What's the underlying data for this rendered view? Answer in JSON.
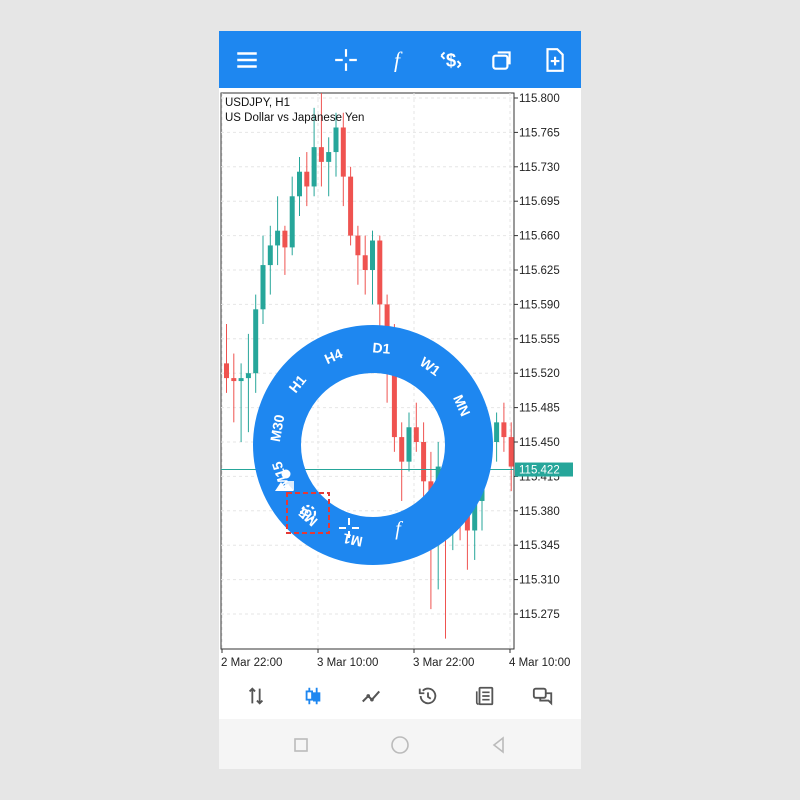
{
  "toolbar": {
    "icons": [
      "menu-icon",
      "crosshair-icon",
      "function-icon",
      "trade-icon",
      "window-icon",
      "new-order-icon"
    ]
  },
  "chart": {
    "symbol": "USDJPY, H1",
    "description": "US Dollar vs Japanese Yen",
    "current_price": "115.422",
    "price_labels": [
      "115.800",
      "115.765",
      "115.730",
      "115.695",
      "115.660",
      "115.625",
      "115.590",
      "115.555",
      "115.520",
      "115.485",
      "115.450",
      "115.415",
      "115.380",
      "115.345",
      "115.310",
      "115.275"
    ],
    "time_labels": [
      "2 Mar 22:00",
      "3 Mar 10:00",
      "3 Mar 22:00",
      "4 Mar 10:00"
    ],
    "colors": {
      "up": "#26a69a",
      "down": "#ef5350",
      "accent": "#1e87f0"
    }
  },
  "chart_data": {
    "type": "candlestick",
    "symbol": "USDJPY",
    "timeframe": "H1",
    "ylim": [
      115.25,
      115.81
    ],
    "grid": true,
    "candles": [
      {
        "o": 115.53,
        "h": 115.57,
        "l": 115.5,
        "c": 115.515
      },
      {
        "o": 115.515,
        "h": 115.54,
        "l": 115.47,
        "c": 115.512
      },
      {
        "o": 115.512,
        "h": 115.53,
        "l": 115.45,
        "c": 115.515
      },
      {
        "o": 115.515,
        "h": 115.56,
        "l": 115.46,
        "c": 115.52
      },
      {
        "o": 115.52,
        "h": 115.6,
        "l": 115.5,
        "c": 115.585
      },
      {
        "o": 115.585,
        "h": 115.66,
        "l": 115.57,
        "c": 115.63
      },
      {
        "o": 115.63,
        "h": 115.67,
        "l": 115.6,
        "c": 115.65
      },
      {
        "o": 115.65,
        "h": 115.7,
        "l": 115.63,
        "c": 115.665
      },
      {
        "o": 115.665,
        "h": 115.67,
        "l": 115.62,
        "c": 115.648
      },
      {
        "o": 115.648,
        "h": 115.72,
        "l": 115.64,
        "c": 115.7
      },
      {
        "o": 115.7,
        "h": 115.74,
        "l": 115.68,
        "c": 115.725
      },
      {
        "o": 115.725,
        "h": 115.745,
        "l": 115.69,
        "c": 115.71
      },
      {
        "o": 115.71,
        "h": 115.79,
        "l": 115.7,
        "c": 115.75
      },
      {
        "o": 115.75,
        "h": 115.805,
        "l": 115.71,
        "c": 115.735
      },
      {
        "o": 115.735,
        "h": 115.76,
        "l": 115.7,
        "c": 115.745
      },
      {
        "o": 115.745,
        "h": 115.785,
        "l": 115.72,
        "c": 115.77
      },
      {
        "o": 115.77,
        "h": 115.785,
        "l": 115.69,
        "c": 115.72
      },
      {
        "o": 115.72,
        "h": 115.73,
        "l": 115.65,
        "c": 115.66
      },
      {
        "o": 115.66,
        "h": 115.67,
        "l": 115.61,
        "c": 115.64
      },
      {
        "o": 115.64,
        "h": 115.66,
        "l": 115.6,
        "c": 115.625
      },
      {
        "o": 115.625,
        "h": 115.665,
        "l": 115.59,
        "c": 115.655
      },
      {
        "o": 115.655,
        "h": 115.66,
        "l": 115.56,
        "c": 115.59
      },
      {
        "o": 115.59,
        "h": 115.6,
        "l": 115.49,
        "c": 115.56
      },
      {
        "o": 115.56,
        "h": 115.57,
        "l": 115.44,
        "c": 115.455
      },
      {
        "o": 115.455,
        "h": 115.47,
        "l": 115.39,
        "c": 115.43
      },
      {
        "o": 115.43,
        "h": 115.48,
        "l": 115.42,
        "c": 115.465
      },
      {
        "o": 115.465,
        "h": 115.49,
        "l": 115.44,
        "c": 115.45
      },
      {
        "o": 115.45,
        "h": 115.47,
        "l": 115.38,
        "c": 115.41
      },
      {
        "o": 115.41,
        "h": 115.44,
        "l": 115.28,
        "c": 115.4
      },
      {
        "o": 115.4,
        "h": 115.45,
        "l": 115.3,
        "c": 115.425
      },
      {
        "o": 115.425,
        "h": 115.45,
        "l": 115.25,
        "c": 115.4
      },
      {
        "o": 115.4,
        "h": 115.44,
        "l": 115.34,
        "c": 115.42
      },
      {
        "o": 115.42,
        "h": 115.43,
        "l": 115.35,
        "c": 115.38
      },
      {
        "o": 115.38,
        "h": 115.4,
        "l": 115.32,
        "c": 115.36
      },
      {
        "o": 115.36,
        "h": 115.42,
        "l": 115.33,
        "c": 115.39
      },
      {
        "o": 115.39,
        "h": 115.45,
        "l": 115.36,
        "c": 115.44
      },
      {
        "o": 115.44,
        "h": 115.47,
        "l": 115.42,
        "c": 115.45
      },
      {
        "o": 115.45,
        "h": 115.48,
        "l": 115.43,
        "c": 115.47
      },
      {
        "o": 115.47,
        "h": 115.49,
        "l": 115.44,
        "c": 115.455
      },
      {
        "o": 115.455,
        "h": 115.47,
        "l": 115.4,
        "c": 115.425
      }
    ]
  },
  "timeframe_menu": {
    "items": [
      "M1",
      "M5",
      "M15",
      "M30",
      "H1",
      "H4",
      "D1",
      "W1",
      "MN"
    ],
    "icons": [
      "objects-icon",
      "settings-icon",
      "crosshair-icon",
      "function-icon"
    ]
  },
  "bottom_nav": {
    "icons": [
      "quotes-icon",
      "chart-icon",
      "trade-icon",
      "history-icon",
      "news-icon",
      "messages-icon"
    ],
    "active": "chart-icon"
  },
  "system_nav": {
    "icons": [
      "recents-icon",
      "home-icon",
      "back-icon"
    ]
  }
}
